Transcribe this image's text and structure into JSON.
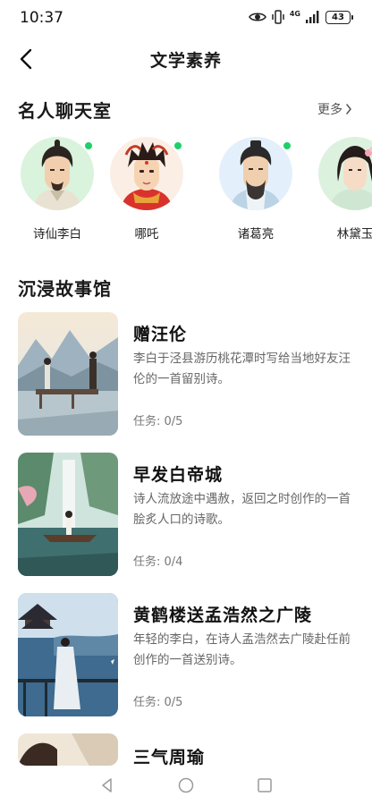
{
  "status_bar": {
    "time": "10:37",
    "network": "4G",
    "battery": "43"
  },
  "header": {
    "title": "文学素养"
  },
  "celebrity_section": {
    "title": "名人聊天室",
    "more_label": "更多",
    "items": [
      {
        "name": "诗仙李白",
        "online": true
      },
      {
        "name": "哪吒",
        "online": true
      },
      {
        "name": "诸葛亮",
        "online": true
      },
      {
        "name": "林黛玉",
        "online": false
      }
    ]
  },
  "story_section": {
    "title": "沉浸故事馆",
    "items": [
      {
        "title": "赠汪伦",
        "description": "李白于泾县游历桃花潭时写给当地好友汪伦的一首留别诗。",
        "task": "任务: 0/5"
      },
      {
        "title": "早发白帝城",
        "description": "诗人流放途中遇赦，返回之时创作的一首脍炙人口的诗歌。",
        "task": "任务: 0/4"
      },
      {
        "title": "黄鹤楼送孟浩然之广陵",
        "description": "年轻的李白，在诗人孟浩然去广陵赴任前创作的一首送别诗。",
        "task": "任务: 0/5"
      },
      {
        "title": "三气周瑜",
        "description": "",
        "task": ""
      }
    ]
  },
  "colors": {
    "online": "#1fcf6a",
    "text_primary": "#111111",
    "text_secondary": "#666666"
  },
  "icons": [
    "back-icon",
    "chevron-right-icon",
    "eye-icon",
    "vibrate-icon",
    "signal-icon",
    "battery-icon",
    "nav-back-icon",
    "nav-home-icon",
    "nav-recent-icon"
  ]
}
